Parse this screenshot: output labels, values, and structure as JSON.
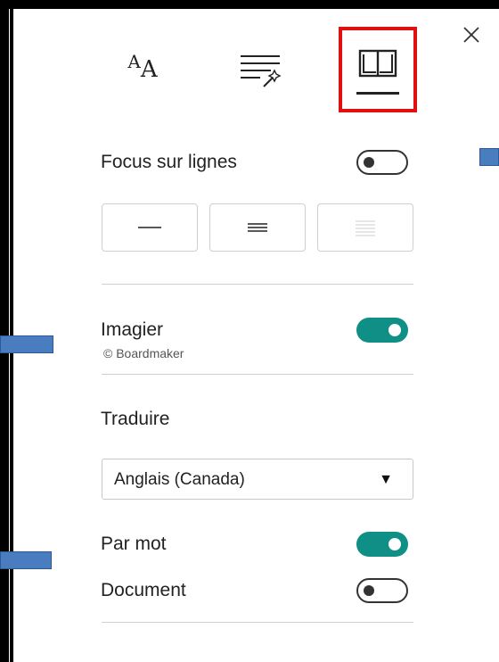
{
  "tabs": [
    {
      "name": "text-options",
      "glyph_big": "A",
      "glyph_small": "A"
    },
    {
      "name": "text-preferences"
    },
    {
      "name": "reading-preferences",
      "selected": true
    }
  ],
  "focus_lines": {
    "label": "Focus sur lignes",
    "enabled": false
  },
  "imagier": {
    "label": "Imagier",
    "credit": "© Boardmaker",
    "enabled": true
  },
  "traduire": {
    "label": "Traduire",
    "language": "Anglais (Canada)",
    "arrow": "▼",
    "par_mot_label": "Par mot",
    "par_mot_enabled": true,
    "document_label": "Document",
    "document_enabled": false
  },
  "colors": {
    "accent": "#0f8f86",
    "highlight_border": "#e01010",
    "marker": "#4a7cc0"
  }
}
